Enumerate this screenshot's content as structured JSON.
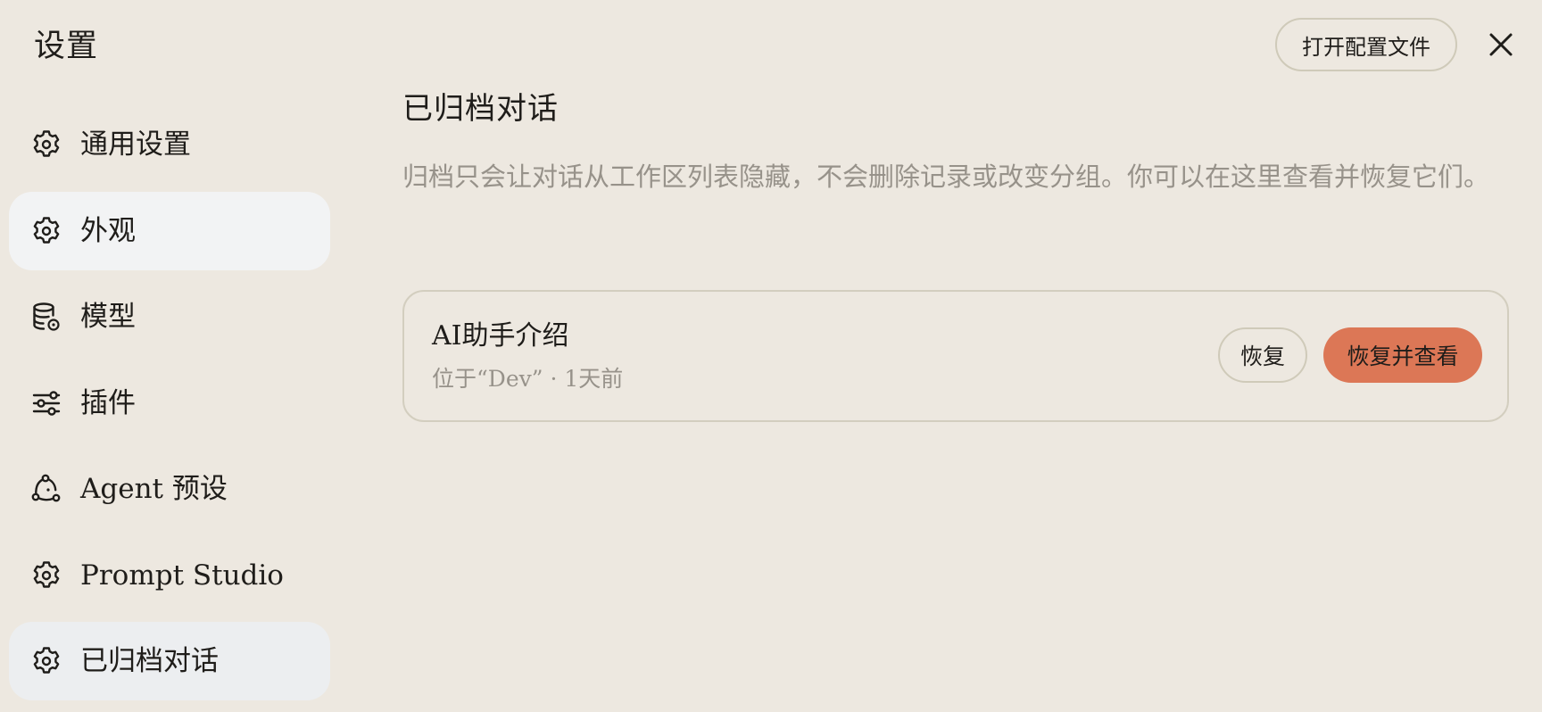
{
  "header": {
    "title": "设置",
    "open_config_label": "打开配置文件",
    "close_icon": "close-icon"
  },
  "sidebar": {
    "items": [
      {
        "label": "通用设置",
        "icon": "gear-icon",
        "state": "normal"
      },
      {
        "label": "外观",
        "icon": "gear-icon",
        "state": "hovered"
      },
      {
        "label": "模型",
        "icon": "database-gear-icon",
        "state": "normal"
      },
      {
        "label": "插件",
        "icon": "sliders-icon",
        "state": "normal"
      },
      {
        "label": "Agent 预设",
        "icon": "agent-network-icon",
        "state": "normal"
      },
      {
        "label": "Prompt Studio",
        "icon": "gear-icon",
        "state": "normal"
      },
      {
        "label": "已归档对话",
        "icon": "gear-icon",
        "state": "active"
      }
    ]
  },
  "main": {
    "title": "已归档对话",
    "description": "归档只会让对话从工作区列表隐藏，不会删除记录或改变分组。你可以在这里查看并恢复它们。",
    "archived": [
      {
        "title": "AI助手介绍",
        "meta": "位于“Dev” · 1天前",
        "restore_label": "恢复",
        "restore_view_label": "恢复并查看"
      }
    ]
  },
  "colors": {
    "background": "#ede8e0",
    "accent": "#dc7756",
    "muted_text": "#97928a",
    "border": "#cfcab9"
  }
}
